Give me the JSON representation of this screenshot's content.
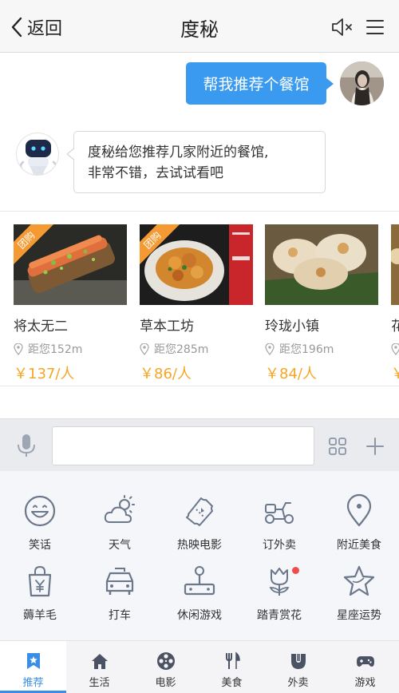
{
  "nav": {
    "back_label": "返回",
    "title": "度秘"
  },
  "chat": {
    "user_message": "帮我推荐个餐馆",
    "bot_message_line1": "度秘给您推荐几家附近的餐馆,",
    "bot_message_line2": "非常不错，去试试看吧"
  },
  "restaurants": [
    {
      "name": "将太无二",
      "distance": "距您152m",
      "price": "￥137/人",
      "tag": "团购"
    },
    {
      "name": "草本工坊",
      "distance": "距您285m",
      "price": "￥86/人",
      "tag": "团购"
    },
    {
      "name": "玲珑小镇",
      "distance": "距您196m",
      "price": "￥84/人"
    },
    {
      "name": "花",
      "distance": "距",
      "price": "￥"
    }
  ],
  "input": {
    "placeholder": "",
    "value": ""
  },
  "features": [
    {
      "label": "笑话",
      "icon": "smile-face-icon"
    },
    {
      "label": "天气",
      "icon": "weather-cloud-sun-icon"
    },
    {
      "label": "热映电影",
      "icon": "movie-ticket-icon"
    },
    {
      "label": "订外卖",
      "icon": "delivery-scooter-icon"
    },
    {
      "label": "附近美食",
      "icon": "location-pin-icon"
    },
    {
      "label": "薅羊毛",
      "icon": "shopping-bag-yen-icon"
    },
    {
      "label": "打车",
      "icon": "taxi-icon"
    },
    {
      "label": "休闲游戏",
      "icon": "joystick-icon"
    },
    {
      "label": "踏青赏花",
      "icon": "tulip-flower-icon",
      "badge": true
    },
    {
      "label": "星座运势",
      "icon": "star-icon"
    }
  ],
  "tabs": [
    {
      "label": "推荐",
      "icon": "bookmark-star-icon",
      "active": true
    },
    {
      "label": "生活",
      "icon": "home-icon"
    },
    {
      "label": "电影",
      "icon": "film-reel-icon"
    },
    {
      "label": "美食",
      "icon": "fork-knife-icon"
    },
    {
      "label": "外卖",
      "icon": "takeout-icon"
    },
    {
      "label": "游戏",
      "icon": "gamepad-icon"
    }
  ],
  "colors": {
    "accent": "#3a8ee6",
    "user_bubble": "#3a9af0",
    "price": "#f5a623",
    "tag": "#f59a32",
    "badge": "#f24b4b"
  }
}
